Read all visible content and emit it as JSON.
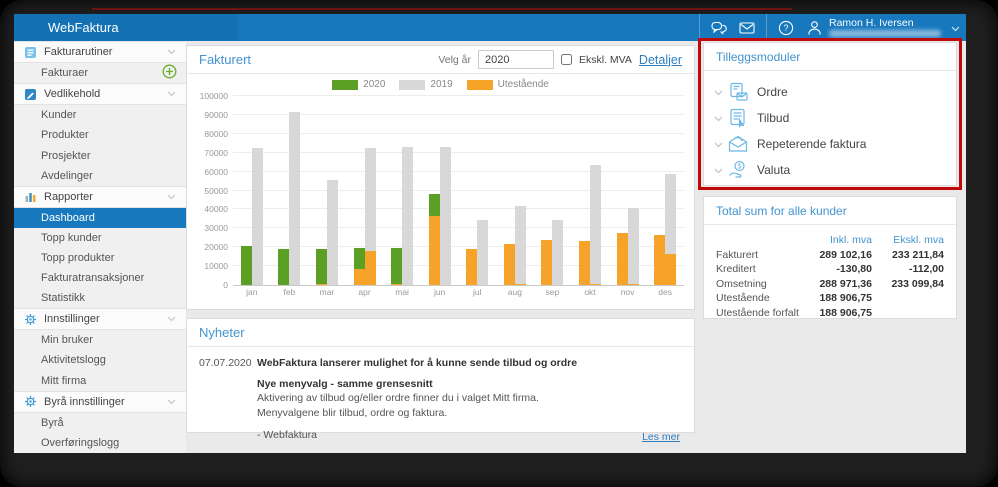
{
  "topbar": {
    "app_name": "WebFaktura",
    "user_name": "Ramon H. Iversen",
    "icons": [
      "chat-icon",
      "mail-icon",
      "help-icon",
      "user-icon",
      "chevron-down-icon"
    ]
  },
  "sidebar": {
    "items": [
      {
        "type": "header",
        "label": "Fakturarutiner",
        "icon": "invoice-routines-icon"
      },
      {
        "type": "sub",
        "label": "Fakturaer",
        "plus": true
      },
      {
        "type": "header",
        "label": "Vedlikehold",
        "icon": "maintenance-icon"
      },
      {
        "type": "sub",
        "label": "Kunder"
      },
      {
        "type": "sub",
        "label": "Produkter"
      },
      {
        "type": "sub",
        "label": "Prosjekter"
      },
      {
        "type": "sub",
        "label": "Avdelinger"
      },
      {
        "type": "header",
        "label": "Rapporter",
        "icon": "reports-icon"
      },
      {
        "type": "sub",
        "label": "Dashboard",
        "selected": true
      },
      {
        "type": "sub",
        "label": "Topp kunder"
      },
      {
        "type": "sub",
        "label": "Topp produkter"
      },
      {
        "type": "sub",
        "label": "Fakturatransaksjoner"
      },
      {
        "type": "sub",
        "label": "Statistikk"
      },
      {
        "type": "header",
        "label": "Innstillinger",
        "icon": "settings-icon"
      },
      {
        "type": "sub",
        "label": "Min bruker"
      },
      {
        "type": "sub",
        "label": "Aktivitetslogg"
      },
      {
        "type": "sub",
        "label": "Mitt firma"
      },
      {
        "type": "header",
        "label": "Byrå innstillinger",
        "icon": "agency-settings-icon"
      },
      {
        "type": "sub",
        "label": "Byrå"
      },
      {
        "type": "sub",
        "label": "Overføringslogg"
      }
    ]
  },
  "chart_panel": {
    "title": "Fakturert",
    "velg_ar_label": "Velg år",
    "year_value": "2020",
    "ekskl_mva_label": "Ekskl. MVA",
    "detaljer_label": "Detaljer"
  },
  "chart_data": {
    "type": "bar",
    "title": "Fakturert",
    "categories": [
      "jan",
      "feb",
      "mar",
      "apr",
      "mai",
      "jun",
      "jul",
      "aug",
      "sep",
      "okt",
      "nov",
      "des"
    ],
    "series": [
      {
        "name": "2020",
        "role": "invoiced-2020-total",
        "color": "#5ba024",
        "values": [
          20500,
          19000,
          19000,
          19500,
          19800,
          48000,
          19000,
          21500,
          24000,
          23500,
          27500,
          26500
        ]
      },
      {
        "name": "2019",
        "role": "invoiced-2019",
        "color": "#d8d8d8",
        "values": [
          72500,
          91500,
          55500,
          72500,
          73000,
          73200,
          34500,
          42000,
          34500,
          63500,
          40500,
          58500
        ]
      },
      {
        "name": "Utestående",
        "role": "outstanding-on-2020-bar",
        "color": "#f7a229",
        "values": [
          0,
          0,
          500,
          8500,
          500,
          36500,
          19000,
          21500,
          24000,
          23500,
          27500,
          26500
        ]
      },
      {
        "name": "Utestående",
        "role": "outstanding-on-2019-bar",
        "color": "#f7a229",
        "values": [
          0,
          0,
          0,
          18000,
          0,
          0,
          0,
          300,
          0,
          500,
          500,
          16500
        ]
      }
    ],
    "legend": [
      {
        "label": "2020",
        "color": "#5ba024"
      },
      {
        "label": "2019",
        "color": "#d8d8d8"
      },
      {
        "label": "Utestående",
        "color": "#f7a229"
      }
    ],
    "legend_position": "top",
    "grid": true,
    "ylim": [
      0,
      100000
    ],
    "y_ticks": [
      0,
      10000,
      20000,
      30000,
      40000,
      50000,
      60000,
      70000,
      80000,
      90000,
      100000
    ]
  },
  "modules": {
    "title": "Tilleggsmoduler",
    "items": [
      {
        "label": "Ordre",
        "icon": "ordre-icon"
      },
      {
        "label": "Tilbud",
        "icon": "tilbud-icon"
      },
      {
        "label": "Repeterende faktura",
        "icon": "repeterende-faktura-icon"
      },
      {
        "label": "Valuta",
        "icon": "valuta-icon"
      }
    ]
  },
  "totals": {
    "title": "Total sum for alle kunder",
    "col_incl": "Inkl. mva",
    "col_excl": "Ekskl. mva",
    "rows": [
      {
        "label": "Fakturert",
        "incl": "289 102,16",
        "excl": "233 211,84"
      },
      {
        "label": "Kreditert",
        "incl": "-130,80",
        "excl": "-112,00"
      },
      {
        "label": "Omsetning",
        "incl": "288 971,36",
        "excl": "233 099,84"
      },
      {
        "label": "Utestående",
        "incl": "188 906,75",
        "excl": ""
      },
      {
        "label": "Utestående forfalt",
        "incl": "188 906,75",
        "excl": ""
      }
    ]
  },
  "news": {
    "title": "Nyheter",
    "date": "07.07.2020",
    "headline": "WebFaktura lanserer mulighet for å kunne sende tilbud og ordre",
    "subheadline": "Nye menyvalg - samme grensesnitt",
    "line1": "Aktivering av tilbud og/eller ordre finner du i valget Mitt firma.",
    "line2": "Menyvalgene blir tilbud, ordre og faktura.",
    "signature": "- Webfaktura",
    "read_more": "Les mer"
  },
  "colors": {
    "topbar_blue": "#1878be",
    "selected_blue": "#1878be",
    "panel_title_blue": "#4293cf",
    "link_blue": "#2e7fc1",
    "bar_green": "#5ba024",
    "bar_gray": "#d8d8d8",
    "bar_orange": "#f7a229",
    "annotation_red": "#c00a0a",
    "module_icon_blue": "#6fb8e6"
  }
}
